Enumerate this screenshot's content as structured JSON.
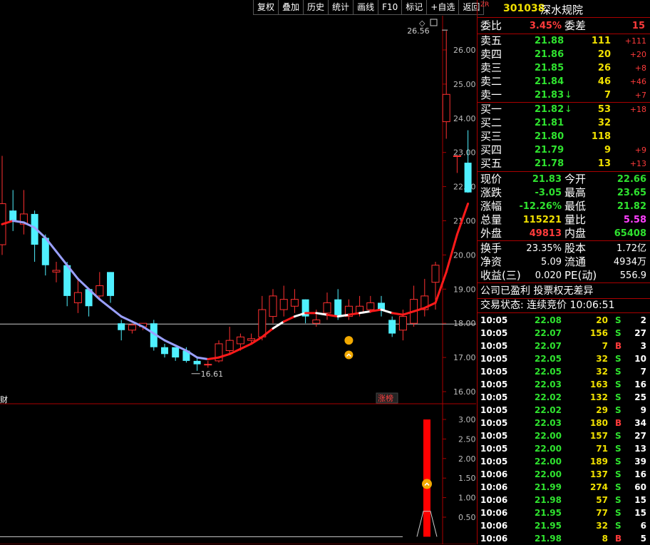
{
  "toolbar": [
    "复权",
    "叠加",
    "历史",
    "统计",
    "画线",
    "F10",
    "标记",
    "+自选",
    "返回"
  ],
  "stock": {
    "prefix": "ZR",
    "code": "301038",
    "name": "深水规院"
  },
  "committee": {
    "ratio_label": "委比",
    "ratio_value": "3.45%",
    "diff_label": "委差",
    "diff_value": "15"
  },
  "sells": [
    {
      "label": "卖五",
      "price": "21.88",
      "vol": "111",
      "chg": "+111",
      "arrow": ""
    },
    {
      "label": "卖四",
      "price": "21.86",
      "vol": "20",
      "chg": "+20",
      "arrow": ""
    },
    {
      "label": "卖三",
      "price": "21.85",
      "vol": "26",
      "chg": "+8",
      "arrow": ""
    },
    {
      "label": "卖二",
      "price": "21.84",
      "vol": "46",
      "chg": "+46",
      "arrow": ""
    },
    {
      "label": "卖一",
      "price": "21.83",
      "vol": "7",
      "chg": "+7",
      "arrow": "↓"
    }
  ],
  "buys": [
    {
      "label": "买一",
      "price": "21.82",
      "vol": "53",
      "chg": "+18",
      "arrow": "↓"
    },
    {
      "label": "买二",
      "price": "21.81",
      "vol": "32",
      "chg": "",
      "arrow": ""
    },
    {
      "label": "买三",
      "price": "21.80",
      "vol": "118",
      "chg": "",
      "arrow": ""
    },
    {
      "label": "买四",
      "price": "21.79",
      "vol": "9",
      "chg": "+9",
      "arrow": ""
    },
    {
      "label": "买五",
      "price": "21.78",
      "vol": "13",
      "chg": "+13",
      "arrow": ""
    }
  ],
  "quote": [
    {
      "l1": "现价",
      "v1": "21.83",
      "c1": "green",
      "l2": "今开",
      "v2": "22.66",
      "c2": "green"
    },
    {
      "l1": "涨跌",
      "v1": "-3.05",
      "c1": "green",
      "l2": "最高",
      "v2": "23.65",
      "c2": "green"
    },
    {
      "l1": "涨幅",
      "v1": "-12.26%",
      "c1": "green",
      "l2": "最低",
      "v2": "21.82",
      "c2": "green"
    },
    {
      "l1": "总量",
      "v1": "115221",
      "c1": "yellow",
      "l2": "量比",
      "v2": "5.58",
      "c2": "magenta"
    },
    {
      "l1": "外盘",
      "v1": "49813",
      "c1": "red",
      "l2": "内盘",
      "v2": "65408",
      "c2": "green"
    }
  ],
  "fund": [
    {
      "l1": "换手",
      "v1": "23.35%",
      "l2": "股本",
      "v2": "1.72亿"
    },
    {
      "l1": "净资",
      "v1": "5.09",
      "l2": "流通",
      "v2": "4934万"
    },
    {
      "l1": "收益(三)",
      "v1": "0.020",
      "l2": "PE(动)",
      "v2": "556.9"
    }
  ],
  "company_status": "公司已盈利 投票权无差异",
  "trade_status": "交易状态: 连续竞价 10:06:51",
  "ticks": [
    {
      "t": "10:05",
      "p": "22.08",
      "v": "20",
      "bs": "S",
      "n": "2"
    },
    {
      "t": "10:05",
      "p": "22.07",
      "v": "156",
      "bs": "S",
      "n": "27"
    },
    {
      "t": "10:05",
      "p": "22.07",
      "v": "7",
      "bs": "B",
      "n": "3"
    },
    {
      "t": "10:05",
      "p": "22.05",
      "v": "32",
      "bs": "S",
      "n": "10"
    },
    {
      "t": "10:05",
      "p": "22.05",
      "v": "32",
      "bs": "S",
      "n": "7"
    },
    {
      "t": "10:05",
      "p": "22.03",
      "v": "163",
      "bs": "S",
      "n": "16"
    },
    {
      "t": "10:05",
      "p": "22.02",
      "v": "132",
      "bs": "S",
      "n": "25"
    },
    {
      "t": "10:05",
      "p": "22.02",
      "v": "29",
      "bs": "S",
      "n": "9"
    },
    {
      "t": "10:05",
      "p": "22.03",
      "v": "180",
      "bs": "B",
      "n": "34"
    },
    {
      "t": "10:05",
      "p": "22.00",
      "v": "157",
      "bs": "S",
      "n": "27"
    },
    {
      "t": "10:05",
      "p": "22.00",
      "v": "71",
      "bs": "S",
      "n": "13"
    },
    {
      "t": "10:05",
      "p": "22.00",
      "v": "189",
      "bs": "S",
      "n": "39"
    },
    {
      "t": "10:06",
      "p": "22.00",
      "v": "137",
      "bs": "S",
      "n": "16"
    },
    {
      "t": "10:06",
      "p": "21.99",
      "v": "274",
      "bs": "S",
      "n": "60"
    },
    {
      "t": "10:06",
      "p": "21.98",
      "v": "57",
      "bs": "S",
      "n": "15"
    },
    {
      "t": "10:06",
      "p": "21.95",
      "v": "77",
      "bs": "S",
      "n": "15"
    },
    {
      "t": "10:06",
      "p": "21.95",
      "v": "32",
      "bs": "S",
      "n": "6"
    },
    {
      "t": "10:06",
      "p": "21.98",
      "v": "8",
      "bs": "B",
      "n": "5"
    }
  ],
  "chart_data": [
    {
      "type": "candlestick",
      "ylim": [
        15.7,
        27.0
      ],
      "yticks": [
        "26.00",
        "25.00",
        "24.00",
        "23.00",
        "22.00",
        "21.00",
        "20.00",
        "19.00",
        "18.00",
        "17.00",
        "16.00"
      ],
      "high_label": "26.56",
      "low_label": "16.61",
      "left_label": "财",
      "tag_label": "涨榜",
      "candles": [
        {
          "o": 20.3,
          "c": 21.5,
          "h": 22.9,
          "l": 20.0
        },
        {
          "o": 21.3,
          "c": 21.0,
          "h": 21.9,
          "l": 20.7
        },
        {
          "o": 20.9,
          "c": 21.2,
          "h": 21.9,
          "l": 20.6
        },
        {
          "o": 21.2,
          "c": 20.3,
          "h": 21.3,
          "l": 19.8
        },
        {
          "o": 20.5,
          "c": 19.7,
          "h": 20.6,
          "l": 19.4
        },
        {
          "o": 19.5,
          "c": 19.55,
          "h": 19.8,
          "l": 19.2
        },
        {
          "o": 19.7,
          "c": 18.8,
          "h": 19.8,
          "l": 18.5
        },
        {
          "o": 18.6,
          "c": 18.9,
          "h": 19.3,
          "l": 18.3
        },
        {
          "o": 19.0,
          "c": 18.5,
          "h": 19.0,
          "l": 18.2
        },
        {
          "o": 18.8,
          "c": 19.1,
          "h": 19.5,
          "l": 18.7
        },
        {
          "o": 19.5,
          "c": 18.8,
          "h": 19.5,
          "l": 18.6
        },
        {
          "o": 18.0,
          "c": 17.8,
          "h": 18.1,
          "l": 17.5
        },
        {
          "o": 17.8,
          "c": 17.95,
          "h": 18.0,
          "l": 17.7
        },
        {
          "o": 17.9,
          "c": 18.0,
          "h": 18.0,
          "l": 17.8
        },
        {
          "o": 18.0,
          "c": 17.3,
          "h": 18.1,
          "l": 17.2
        },
        {
          "o": 17.3,
          "c": 17.1,
          "h": 17.4,
          "l": 17.0
        },
        {
          "o": 17.3,
          "c": 17.0,
          "h": 17.3,
          "l": 16.9
        },
        {
          "o": 17.2,
          "c": 16.9,
          "h": 17.3,
          "l": 16.85
        },
        {
          "o": 16.9,
          "c": 16.8,
          "h": 17.0,
          "l": 16.61
        },
        {
          "o": 16.8,
          "c": 16.8,
          "h": 16.9,
          "l": 16.7
        },
        {
          "o": 16.9,
          "c": 17.4,
          "h": 17.5,
          "l": 16.85
        },
        {
          "o": 17.2,
          "c": 17.5,
          "h": 17.9,
          "l": 17.1
        },
        {
          "o": 17.4,
          "c": 17.6,
          "h": 17.7,
          "l": 17.2
        },
        {
          "o": 17.5,
          "c": 17.55,
          "h": 17.7,
          "l": 17.4
        },
        {
          "o": 17.6,
          "c": 18.4,
          "h": 18.8,
          "l": 17.5
        },
        {
          "o": 18.2,
          "c": 18.8,
          "h": 19.0,
          "l": 18.0
        },
        {
          "o": 18.4,
          "c": 18.7,
          "h": 19.1,
          "l": 18.2
        },
        {
          "o": 18.5,
          "c": 18.7,
          "h": 19.0,
          "l": 18.3
        },
        {
          "o": 18.7,
          "c": 18.2,
          "h": 18.7,
          "l": 18.0
        },
        {
          "o": 18.0,
          "c": 18.1,
          "h": 18.4,
          "l": 17.9
        },
        {
          "o": 18.3,
          "c": 18.6,
          "h": 18.9,
          "l": 18.1
        },
        {
          "o": 18.7,
          "c": 18.2,
          "h": 19.0,
          "l": 18.1
        },
        {
          "o": 18.2,
          "c": 18.5,
          "h": 18.7,
          "l": 18.1
        },
        {
          "o": 18.3,
          "c": 18.5,
          "h": 18.8,
          "l": 18.2
        },
        {
          "o": 18.4,
          "c": 18.6,
          "h": 18.8,
          "l": 18.3
        },
        {
          "o": 18.6,
          "c": 18.4,
          "h": 18.8,
          "l": 18.2
        },
        {
          "o": 18.1,
          "c": 17.7,
          "h": 18.2,
          "l": 17.6
        },
        {
          "o": 17.8,
          "c": 18.2,
          "h": 18.4,
          "l": 17.5
        },
        {
          "o": 18.0,
          "c": 18.7,
          "h": 19.1,
          "l": 17.9
        },
        {
          "o": 18.4,
          "c": 18.8,
          "h": 19.3,
          "l": 18.2
        },
        {
          "o": 19.2,
          "c": 19.7,
          "h": 19.8,
          "l": 18.4
        },
        {
          "o": 23.9,
          "c": 24.7,
          "h": 26.56,
          "l": 23.4
        },
        {
          "o": 22.9,
          "c": 22.9,
          "h": 22.9,
          "l": 22.4
        },
        {
          "o": 22.7,
          "c": 21.83,
          "h": 23.65,
          "l": 21.82
        }
      ],
      "ma": [
        20.9,
        21.0,
        20.95,
        20.8,
        20.5,
        20.1,
        19.7,
        19.3,
        19.0,
        18.7,
        18.45,
        18.2,
        18.05,
        17.9,
        17.7,
        17.5,
        17.35,
        17.2,
        17.0,
        16.95,
        17.0,
        17.1,
        17.25,
        17.4,
        17.6,
        17.85,
        18.05,
        18.2,
        18.3,
        18.3,
        18.25,
        18.2,
        18.25,
        18.3,
        18.35,
        18.4,
        18.3,
        18.25,
        18.35,
        18.45,
        18.6,
        19.5,
        20.6,
        21.5
      ]
    },
    {
      "type": "bar",
      "ylim": [
        0,
        3.2
      ],
      "yticks": [
        "3.00",
        "2.50",
        "2.00",
        "1.50",
        "1.00",
        "0.50"
      ],
      "signal_value": 3.0,
      "signal_index": 40
    }
  ]
}
